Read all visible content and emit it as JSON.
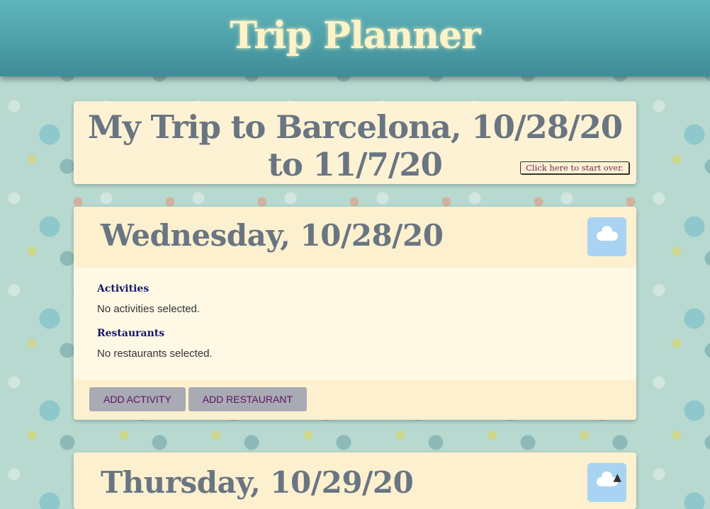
{
  "header": {
    "title": "Trip Planner"
  },
  "trip": {
    "title": "My Trip to Barcelona, 10/28/20 to 11/7/20",
    "restart_label": "Click here to start over."
  },
  "days": [
    {
      "title": "Wednesday, 10/28/20",
      "weather_icon": "cloud-icon",
      "activities_heading": "Activities",
      "activities_text": "No activities selected.",
      "restaurants_heading": "Restaurants",
      "restaurants_text": "No restaurants selected.",
      "add_activity_label": "ADD ACTIVITY",
      "add_restaurant_label": "ADD RESTAURANT"
    },
    {
      "title": "Thursday, 10/29/20",
      "weather_icon": "cloud-night-icon"
    }
  ],
  "colors": {
    "header": "#4aa0a8",
    "title_text": "#fdf3c8",
    "card": "#fdf3d4",
    "day_title": "#6a7582",
    "button": "#a8aab4",
    "button_text": "#5c1362",
    "section_heading": "#14166b"
  }
}
